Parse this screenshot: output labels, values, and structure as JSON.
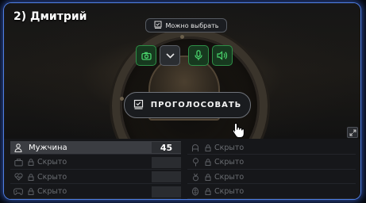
{
  "player": {
    "title": "2) Дмитрий"
  },
  "top_pill": {
    "label": "Можно выбрать",
    "icon": "checklist-icon"
  },
  "controls": [
    {
      "name": "camera-button",
      "icon": "camera-icon",
      "style": "green"
    },
    {
      "name": "dropdown-button",
      "icon": "chevron-down-icon",
      "style": "grey"
    },
    {
      "name": "microphone-button",
      "icon": "microphone-icon",
      "style": "green"
    },
    {
      "name": "speaker-button",
      "icon": "speaker-icon",
      "style": "green"
    }
  ],
  "vote_button": {
    "label": "ПРОГОЛОСОВАТЬ",
    "icon": "checklist-icon"
  },
  "left_cards": [
    {
      "icon": "person-icon",
      "label": "Мужчина",
      "value": "45",
      "locked": false
    },
    {
      "icon": "briefcase-icon",
      "label": "Скрыто",
      "value": "",
      "locked": true
    },
    {
      "icon": "heart-pulse-icon",
      "label": "Скрыто",
      "value": "",
      "locked": true
    },
    {
      "icon": "gamepad-icon",
      "label": "Скрыто",
      "value": "",
      "locked": true
    }
  ],
  "right_cards": [
    {
      "icon": "helmet-icon",
      "label": "Скрыто",
      "locked": true
    },
    {
      "icon": "location-pin-icon",
      "label": "Скрыто",
      "locked": true
    },
    {
      "icon": "medal-icon",
      "label": "Скрыто",
      "locked": true
    },
    {
      "icon": "anatomy-icon",
      "label": "Скрыто",
      "locked": true
    }
  ],
  "colors": {
    "frame_glow": "#4f7fe0",
    "green_button": "#2e8f47",
    "active_row": "#3b3d42"
  }
}
